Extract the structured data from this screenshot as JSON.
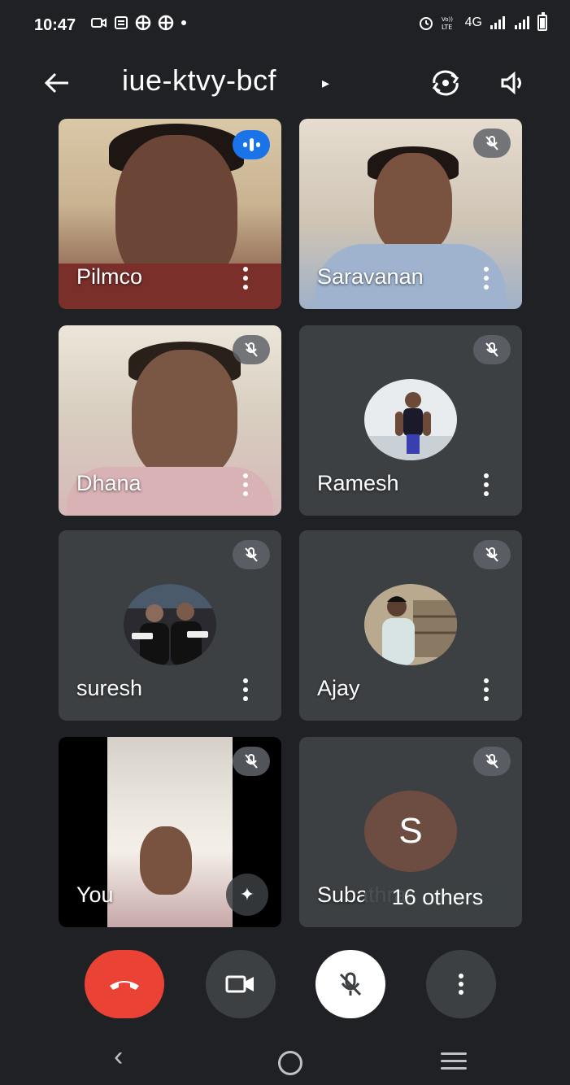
{
  "status_bar": {
    "time": "10:47",
    "network_label": "4G",
    "icons": [
      "screen-record-icon",
      "notes-icon",
      "grid-icon",
      "grid-icon",
      "dot-icon",
      "alarm-icon",
      "volte-icon",
      "signal-icon",
      "signal-icon",
      "battery-icon"
    ]
  },
  "header": {
    "meeting_code": "iue-ktvy-bcf",
    "caret": "▸",
    "back_arrow": "←"
  },
  "participants": [
    {
      "name": "Pilmco",
      "state": "speaking",
      "type": "video"
    },
    {
      "name": "Saravanan",
      "state": "muted",
      "type": "video"
    },
    {
      "name": "Dhana",
      "state": "muted",
      "type": "video"
    },
    {
      "name": "Ramesh",
      "state": "muted",
      "type": "avatar"
    },
    {
      "name": "suresh",
      "state": "muted",
      "type": "avatar"
    },
    {
      "name": "Ajay",
      "state": "muted",
      "type": "avatar"
    },
    {
      "name": "You",
      "state": "muted",
      "type": "self-video"
    },
    {
      "name": "Subathra",
      "state": "muted",
      "type": "letter",
      "initial": "S"
    }
  ],
  "overflow": {
    "label": "16 others"
  },
  "effects_glyph": "✦",
  "colors": {
    "background": "#202124",
    "tile": "#3c4043",
    "speaking": "#1a73e8",
    "end_call": "#ea4335",
    "letter_avatar": "#6d4c41"
  },
  "nav": {
    "back": "‹"
  }
}
